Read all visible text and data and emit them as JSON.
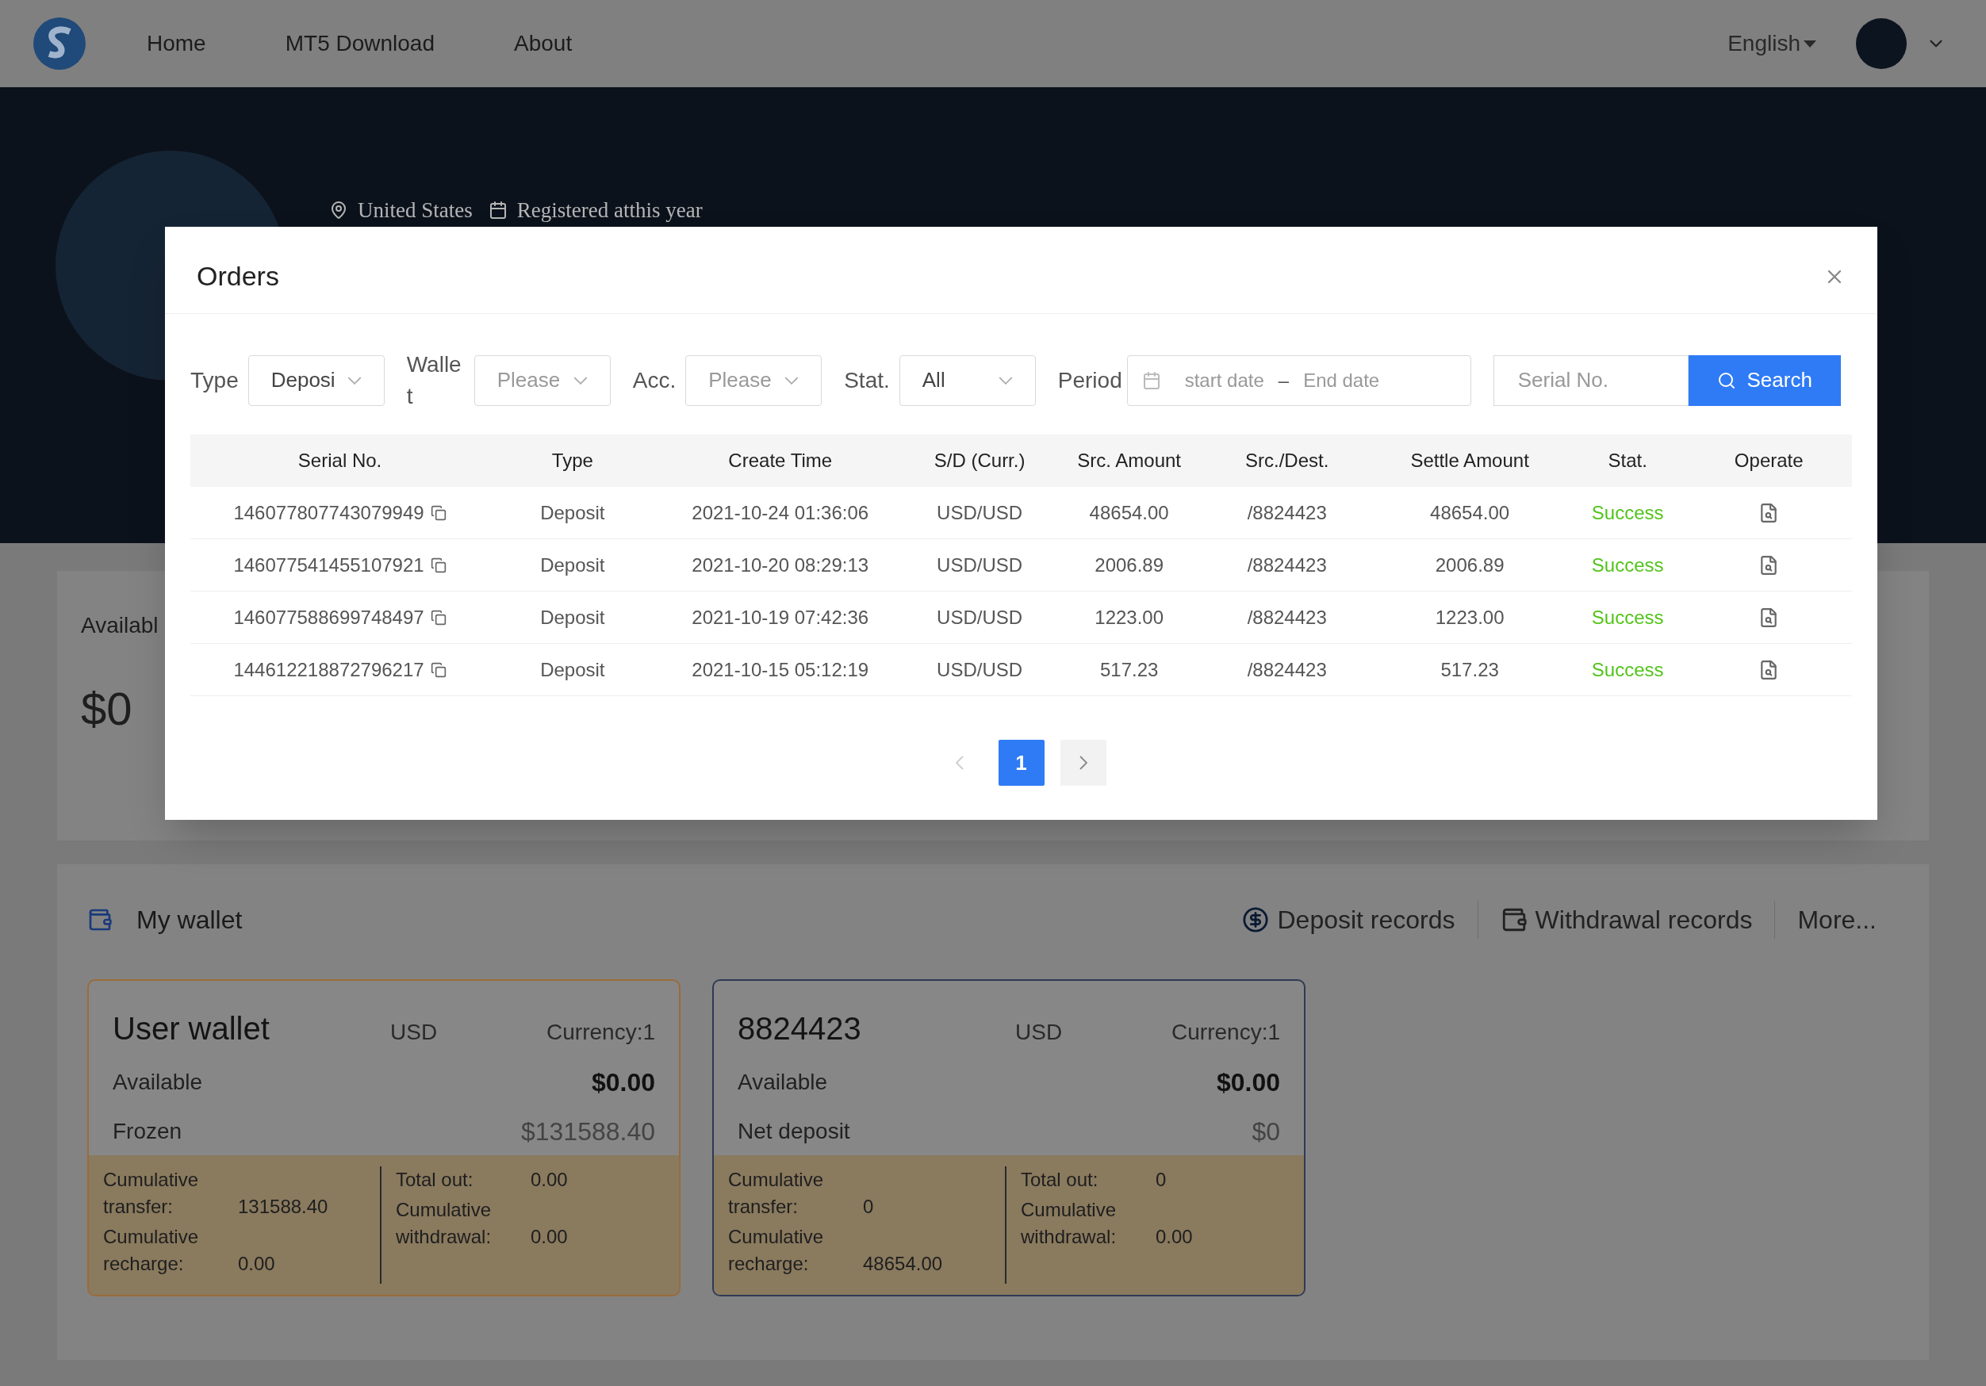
{
  "nav": {
    "items": [
      {
        "label": "Home"
      },
      {
        "label": "MT5 Download"
      },
      {
        "label": "About"
      }
    ],
    "language": "English"
  },
  "hero": {
    "location": "United States",
    "registered": "Registered atthis year"
  },
  "summary_card": {
    "label": "Availabl",
    "value": "$0"
  },
  "wallet_section": {
    "title": "My wallet",
    "links": [
      {
        "label": "Deposit records",
        "kind": "deposit"
      },
      {
        "label": "Withdrawal records",
        "kind": "withdrawal"
      },
      {
        "label": "More...",
        "kind": "more"
      }
    ],
    "wallets": [
      {
        "name": "User wallet",
        "currency": "USD",
        "currency_count": "Currency:1",
        "color": "#9a6b3a",
        "rows": [
          {
            "label": "Available",
            "value": "$0.00",
            "bold": true
          },
          {
            "label": "Frozen",
            "value": "$131588.40",
            "bold": false
          }
        ],
        "stats": [
          [
            {
              "label": "Cumulative transfer:",
              "value": "131588.40"
            },
            {
              "label": "Cumulative recharge:",
              "value": "0.00"
            }
          ],
          [
            {
              "label": "Total out:",
              "value": "0.00"
            },
            {
              "label": "Cumulative withdrawal:",
              "value": "0.00"
            }
          ]
        ]
      },
      {
        "name": "8824423",
        "currency": "USD",
        "currency_count": "Currency:1",
        "color": "#2d3a55",
        "rows": [
          {
            "label": "Available",
            "value": "$0.00",
            "bold": true
          },
          {
            "label": "Net deposit",
            "value": "$0",
            "bold": false
          }
        ],
        "stats": [
          [
            {
              "label": "Cumulative transfer:",
              "value": "0"
            },
            {
              "label": "Cumulative recharge:",
              "value": "48654.00"
            }
          ],
          [
            {
              "label": "Total out:",
              "value": "0"
            },
            {
              "label": "Cumulative withdrawal:",
              "value": "0.00"
            }
          ]
        ]
      }
    ]
  },
  "modal": {
    "title": "Orders",
    "filters": [
      {
        "label": "Type",
        "value": "Deposi"
      },
      {
        "label": "Wallet",
        "placeholder": "Please"
      },
      {
        "label": "Acc.",
        "placeholder": "Please"
      },
      {
        "label": "Stat.",
        "value": "All"
      }
    ],
    "period": {
      "label": "Period",
      "start_placeholder": "start date",
      "separator": "–",
      "end_placeholder": "End date"
    },
    "serial_field": {
      "placeholder": "Serial No."
    },
    "search_button": "Search",
    "table": {
      "columns": [
        "Serial No.",
        "Type",
        "Create Time",
        "S/D (Curr.)",
        "Src. Amount",
        "Src./Dest.",
        "Settle Amount",
        "Stat.",
        "Operate"
      ],
      "rows": [
        {
          "serial": "146077807743079949",
          "type": "Deposit",
          "time": "2021-10-24 01:36:06",
          "curr": "USD/USD",
          "src_amount": "48654.00",
          "dest": "/8824423",
          "settle": "48654.00",
          "status": "Success",
          "color": "#52c41a"
        },
        {
          "serial": "146077541455107921",
          "type": "Deposit",
          "time": "2021-10-20 08:29:13",
          "curr": "USD/USD",
          "src_amount": "2006.89",
          "dest": "/8824423",
          "settle": "2006.89",
          "status": "Success",
          "color": "#52c41a"
        },
        {
          "serial": "146077588699748497",
          "type": "Deposit",
          "time": "2021-10-19 07:42:36",
          "curr": "USD/USD",
          "src_amount": "1223.00",
          "dest": "/8824423",
          "settle": "1223.00",
          "status": "Success",
          "color": "#52c41a"
        },
        {
          "serial": "144612218872796217",
          "type": "Deposit",
          "time": "2021-10-15 05:12:19",
          "curr": "USD/USD",
          "src_amount": "517.23",
          "dest": "/8824423",
          "settle": "517.23",
          "status": "Success",
          "color": "#52c41a"
        }
      ]
    },
    "pagination": {
      "prev_disabled": true,
      "pages": [
        {
          "label": "1",
          "selected": true
        }
      ],
      "next_disabled": false
    }
  }
}
